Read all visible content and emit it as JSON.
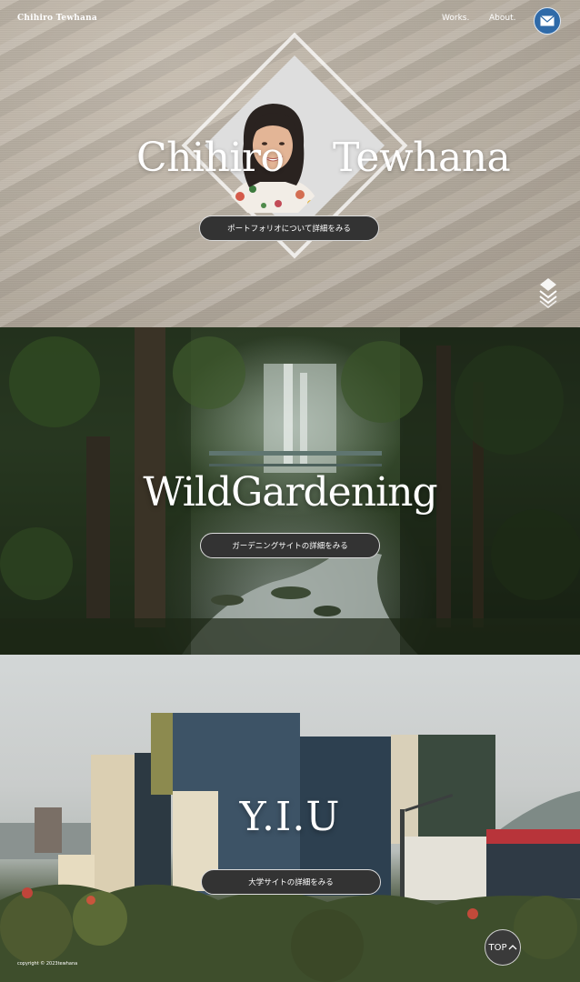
{
  "header": {
    "site_title": "Chihiro Tewhana",
    "nav": [
      {
        "label": "Works."
      },
      {
        "label": "About."
      }
    ],
    "mail_icon": "mail-icon"
  },
  "hero": {
    "name_first": "Chihiro",
    "name_last": "Tewhana",
    "button_label": "ポートフォリオについて詳細をみる",
    "scroll_icon": "layers-scroll-down-icon"
  },
  "works": [
    {
      "title": "WildGardening",
      "button_label": "ガーデニングサイトの詳細をみる"
    },
    {
      "title": "Y.I.U",
      "button_label": "大学サイトの詳細をみる"
    }
  ],
  "footer": {
    "copyright": "copyright © 2023tewhana",
    "top_button": "TOP",
    "top_icon": "chevron-up-icon"
  },
  "colors": {
    "mail_button": "#2f6aa8",
    "pill_button": "#333333",
    "text": "#ffffff"
  }
}
